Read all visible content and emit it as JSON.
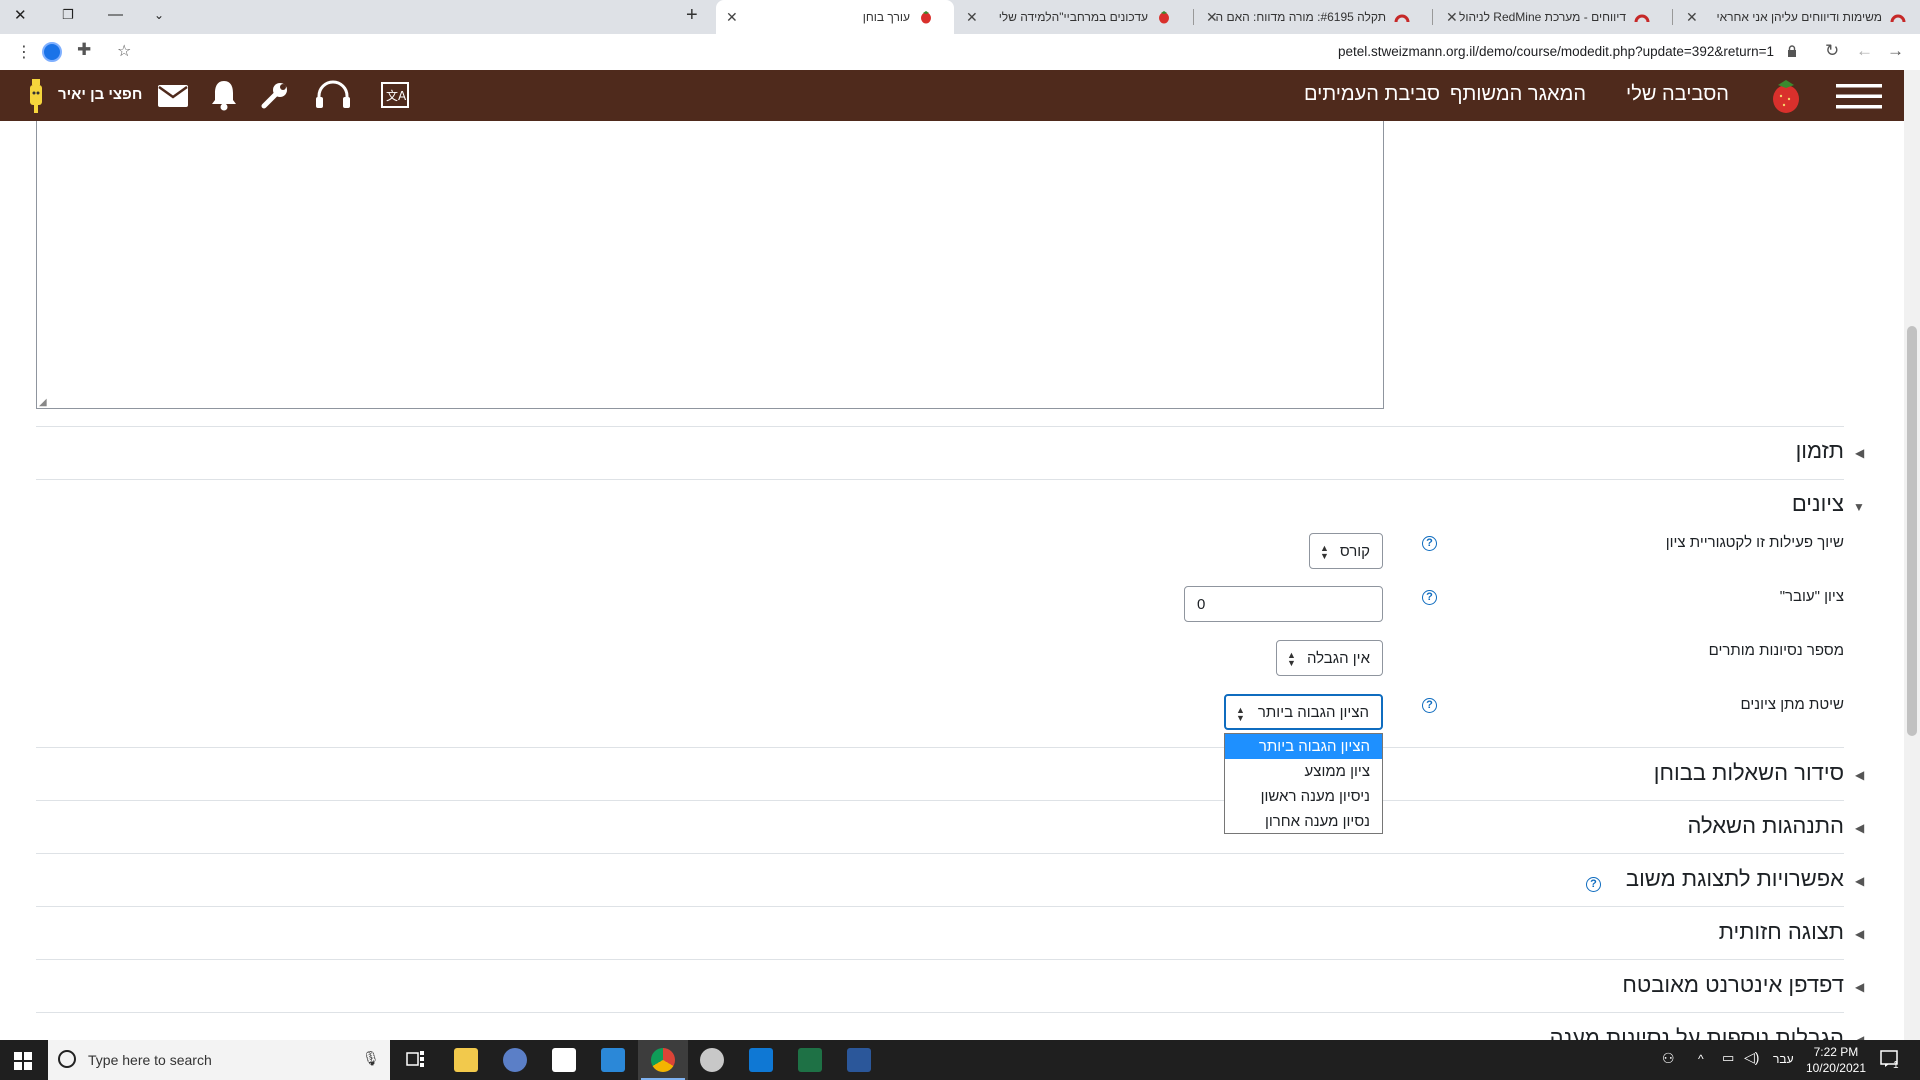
{
  "browser": {
    "tabs": [
      {
        "title": "משימות ודיווחים עליהן אני אחראי",
        "active": false
      },
      {
        "title": "דיווחים - מערכת RedMine לניהול",
        "active": false
      },
      {
        "title": "תקלה #6195: מורה מדווח: האם ה",
        "active": false
      },
      {
        "title": "עדכונים במרחביי\"הלמידה שלי",
        "active": false
      },
      {
        "title": "עורך בוחן",
        "active": true
      }
    ],
    "url": "petel.stweizmann.org.il/demo/course/modedit.php?update=392&return=1"
  },
  "navbar": {
    "links": [
      "הסביבה שלי",
      "המאגר המשותף",
      "סביבת העמיתים"
    ],
    "user_name": "חפצי בן יאיר"
  },
  "sections": {
    "timing": "תזמון",
    "grade": "ציונים",
    "layout": "סידור השאלות בבוחן",
    "question_behaviour": "התנהגות השאלה",
    "review_options": "אפשרויות לתצוגת משוב",
    "appearance": "תצוגה חזותית",
    "safe_browser": "דפדפן אינטרנט מאובטח",
    "extra_restrictions": "הגבלות נוספות על נסיונות מענה"
  },
  "grade_form": {
    "category_label": "שיוך פעילות זו לקטגוריית ציון",
    "category_value": "קורס",
    "pass_label": "ציון \"עובר\"",
    "pass_value": "0",
    "attempts_label": "מספר נסיונות מותרים",
    "attempts_value": "אין הגבלה",
    "method_label": "שיטת מתן ציונים",
    "method_value": "הציון הגבוה ביותר",
    "method_options": [
      "הציון הגבוה ביותר",
      "ציון ממוצע",
      "ניסיון מענה ראשון",
      "נסיון מענה אחרון"
    ]
  },
  "taskbar": {
    "search_placeholder": "Type here to search",
    "language": "עבר",
    "time": "7:22 PM",
    "date": "10/20/2021",
    "notifications": "1"
  },
  "colors": {
    "navbar": "#4f2a1c",
    "accent": "#0f6cbf",
    "selected_option": "#1e90ff"
  }
}
